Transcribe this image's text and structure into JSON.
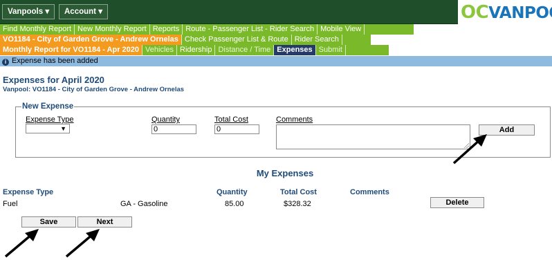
{
  "topbar": {
    "menus": [
      "Vanpools ▾",
      "Account ▾"
    ],
    "logo_oc": "OC",
    "logo_van": "VANPOOL"
  },
  "nav_row1": [
    "Find Monthly Report",
    "New Monthly Report",
    "Reports",
    "Route - Passenger List - Rider Search",
    "Mobile View"
  ],
  "nav_row2": {
    "vanpool": "VO1184 - City of Garden Grove - Andrew Ornelas",
    "links": [
      "Check Passenger List & Route",
      "Rider Search"
    ]
  },
  "nav_row3": {
    "report": "Monthly Report for VO1184 - Apr 2020",
    "tabs": [
      "Vehicles",
      "Ridership",
      "Distance / Time",
      "Expenses",
      "Submit"
    ],
    "active_tab": "Expenses"
  },
  "banner": {
    "icon": "info-icon",
    "message": "Expense has been added"
  },
  "header": {
    "title": "Expenses for April 2020",
    "subtitle": "Vanpool: VO1184 - City of Garden Grove - Andrew Ornelas"
  },
  "new_expense": {
    "legend": "New Expense",
    "expense_type_label": "Expense Type",
    "expense_type_value": "",
    "quantity_label": "Quantity",
    "quantity_value": "0",
    "total_cost_label": "Total Cost",
    "total_cost_value": "0",
    "comments_label": "Comments",
    "comments_value": "",
    "add_label": "Add"
  },
  "my_expenses": {
    "title": "My Expenses",
    "columns": [
      "Expense Type",
      "Quantity",
      "Total Cost",
      "Comments"
    ],
    "rows": [
      {
        "type": "Fuel",
        "subtype": "GA - Gasoline",
        "quantity": "85.00",
        "total_cost": "$328.32",
        "comments": "",
        "delete_label": "Delete"
      }
    ]
  },
  "actions": {
    "save_label": "Save",
    "next_label": "Next"
  },
  "colors": {
    "dark_green": "#1f4f2a",
    "light_green": "#7ab929",
    "orange": "#f39a1f",
    "navy_tab": "#263a68",
    "banner_blue": "#8fbadf",
    "heading_blue": "#1f4b7a"
  }
}
